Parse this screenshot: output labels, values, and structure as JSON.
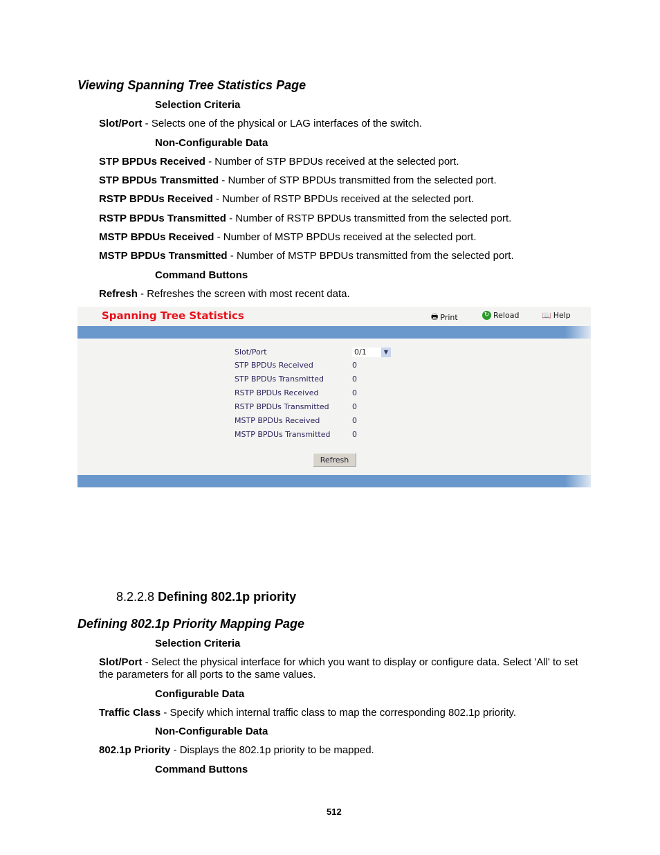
{
  "section1": {
    "title": "Viewing Spanning Tree Statistics Page",
    "sel_heading": "Selection Criteria",
    "slot_term": "Slot/Port",
    "slot_desc": " - Selects one of the physical or LAG interfaces of the switch.",
    "noncfg_heading": "Non-Configurable Data",
    "items": [
      {
        "term": "STP BPDUs Received",
        "desc": " - Number of STP BPDUs received at the selected port."
      },
      {
        "term": "STP BPDUs Transmitted",
        "desc": " - Number of STP BPDUs transmitted from the selected port."
      },
      {
        "term": "RSTP BPDUs Received",
        "desc": " - Number of RSTP BPDUs received at the selected port."
      },
      {
        "term": "RSTP BPDUs Transmitted",
        "desc": " - Number of RSTP BPDUs transmitted from the selected port."
      },
      {
        "term": "MSTP BPDUs Received",
        "desc": " - Number of MSTP BPDUs received at the selected port."
      },
      {
        "term": "MSTP BPDUs Transmitted",
        "desc": " - Number of MSTP BPDUs transmitted from the selected port."
      }
    ],
    "cmd_heading": "Command Buttons",
    "refresh_term": "Refresh",
    "refresh_desc": " - Refreshes the screen with most recent data."
  },
  "panel": {
    "title": "Spanning Tree Statistics",
    "toolbar": [
      {
        "label": "Print",
        "icon": "printer-icon"
      },
      {
        "label": "Reload",
        "icon": "reload-icon"
      },
      {
        "label": "Help",
        "icon": "help-book-icon"
      }
    ],
    "slot_label": "Slot/Port",
    "slot_value": "0/1",
    "rows": [
      {
        "label": "STP BPDUs Received",
        "value": "0"
      },
      {
        "label": "STP BPDUs Transmitted",
        "value": "0"
      },
      {
        "label": "RSTP BPDUs Received",
        "value": "0"
      },
      {
        "label": "RSTP BPDUs Transmitted",
        "value": "0"
      },
      {
        "label": "MSTP BPDUs Received",
        "value": "0"
      },
      {
        "label": "MSTP BPDUs Transmitted",
        "value": "0"
      }
    ],
    "refresh_label": "Refresh",
    "colors": {
      "title": "#e8101a",
      "bar": "#6a98cc",
      "background": "#f3f3f1"
    }
  },
  "section2": {
    "number": "8.2.2.8",
    "heading": "Defining 802.1p priority",
    "title": "Defining 802.1p Priority Mapping Page",
    "sel_heading": "Selection Criteria",
    "slot_term": "Slot/Port",
    "slot_desc1": " - Select the physical interface for which you want to display or configure data. Select 'All' to set",
    "slot_desc2": "the parameters for all ports to the same values.",
    "cfg_heading": "Configurable Data",
    "tc_term": "Traffic Class",
    "tc_desc": " - Specify which internal traffic class to map the corresponding 802.1p priority.",
    "noncfg_heading": "Non-Configurable Data",
    "prio_term": "802.1p Priority",
    "prio_desc": " - Displays the 802.1p priority to be mapped.",
    "cmd_heading": "Command Buttons"
  },
  "page_number": "512"
}
